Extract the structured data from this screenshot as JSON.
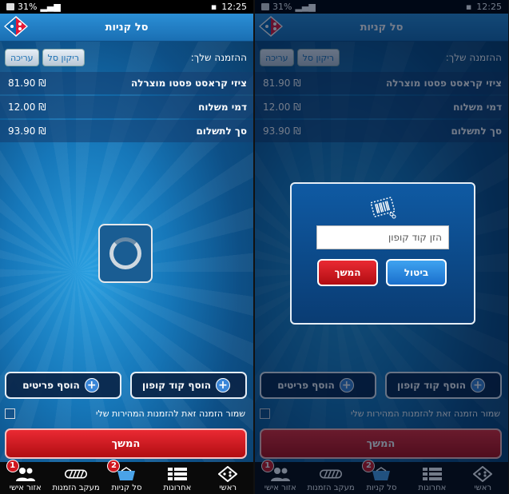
{
  "status_bar": {
    "battery": "31%",
    "time": "12:25"
  },
  "header": {
    "title": "סל קניות"
  },
  "order": {
    "label": "ההזמנה שלך:",
    "empty_cart_button": "ריקון סל",
    "edit_button": "עריכה",
    "items": [
      {
        "name": "ציזי קראסט פסטו מוצרלה",
        "price": "81.90 ₪"
      },
      {
        "name": "דמי משלוח",
        "price": "12.00 ₪"
      },
      {
        "name": "סך לתשלום",
        "price": "93.90 ₪"
      }
    ]
  },
  "actions": {
    "add_coupon": "הוסף קוד קופון",
    "add_items": "הוסף פריטים",
    "save_order": "שמור הזמנה זאת להזמנות המהירות שלי",
    "continue": "המשך"
  },
  "nav": {
    "items": [
      {
        "label": "ראשי",
        "icon": "domino-icon",
        "badge": ""
      },
      {
        "label": "אחרונות",
        "icon": "list-icon",
        "badge": ""
      },
      {
        "label": "סל קניות",
        "icon": "cart-icon",
        "badge": "2"
      },
      {
        "label": "מעקב הזמנות",
        "icon": "tracker-icon",
        "badge": ""
      },
      {
        "label": "אזור אישי",
        "icon": "users-icon",
        "badge": "1"
      }
    ]
  },
  "coupon_dialog": {
    "placeholder": "הזן קוד קופון",
    "cancel": "ביטול",
    "continue": "המשך"
  },
  "colors": {
    "accent_red": "#d01820",
    "accent_blue": "#1a6fb3"
  }
}
